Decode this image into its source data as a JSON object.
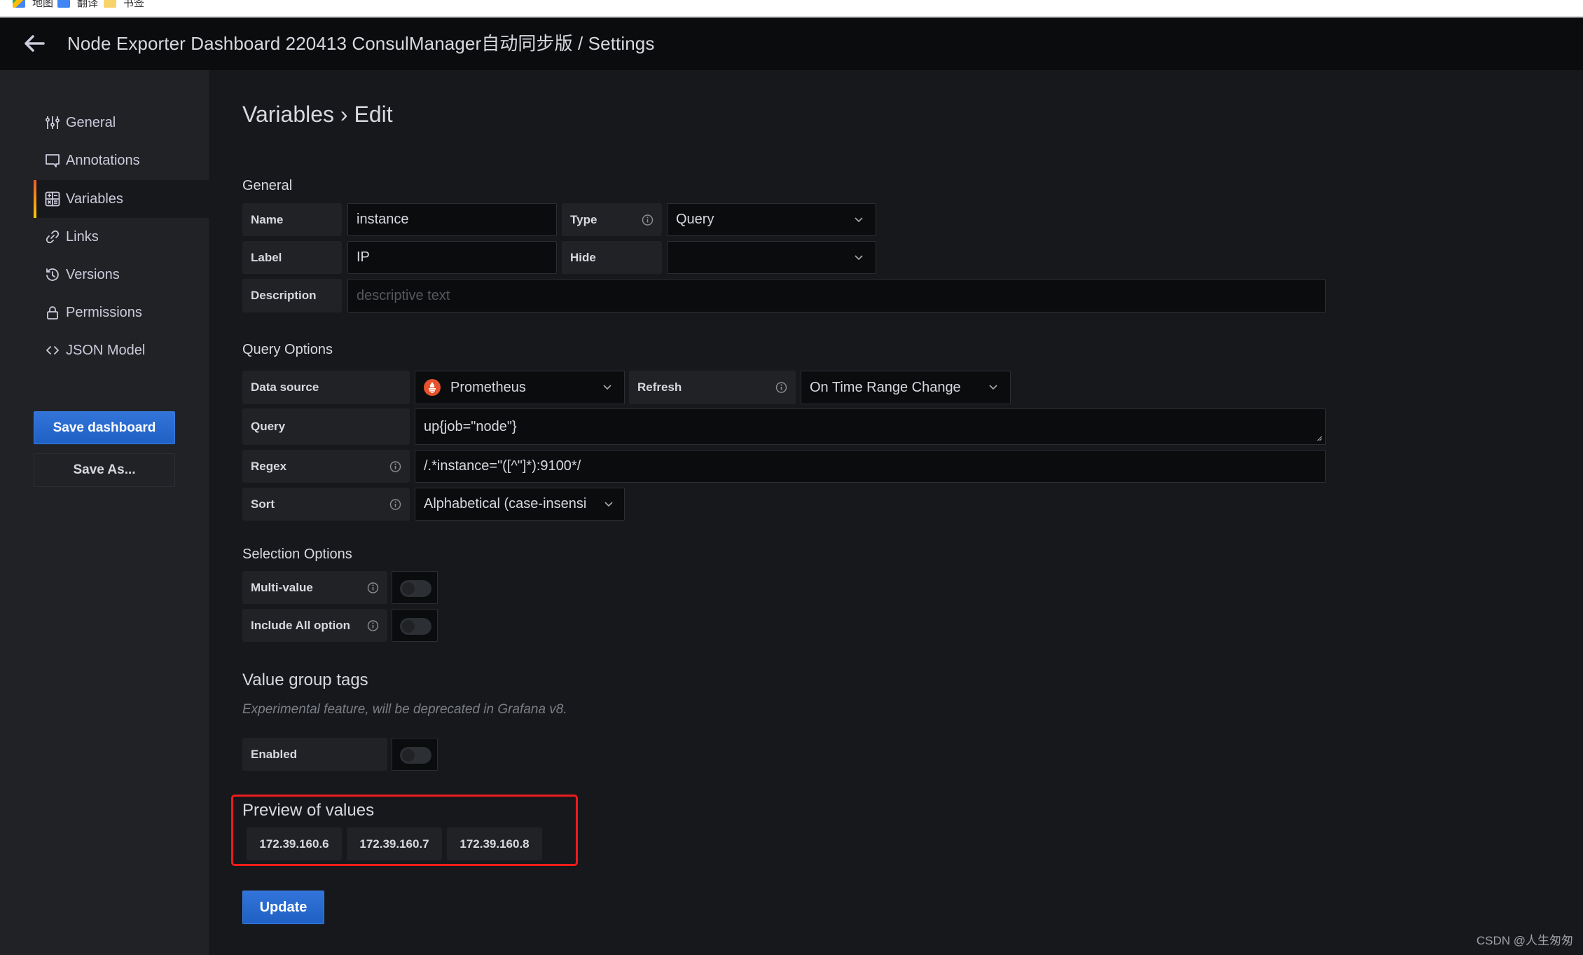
{
  "browser": {
    "bookmarks": [
      {
        "label": "地图",
        "icon": "maps-icon"
      },
      {
        "label": "翻译",
        "icon": "translate-icon"
      },
      {
        "label": "书签",
        "icon": "folder-icon"
      }
    ]
  },
  "header": {
    "title": "Node Exporter Dashboard 220413 ConsulManager自动同步版 / Settings",
    "back_icon": "arrow-left-icon"
  },
  "sidebar": {
    "items": [
      {
        "label": "General",
        "icon": "sliders-icon",
        "active": false
      },
      {
        "label": "Annotations",
        "icon": "comment-icon",
        "active": false
      },
      {
        "label": "Variables",
        "icon": "calculator-icon",
        "active": true
      },
      {
        "label": "Links",
        "icon": "link-icon",
        "active": false
      },
      {
        "label": "Versions",
        "icon": "history-icon",
        "active": false
      },
      {
        "label": "Permissions",
        "icon": "lock-icon",
        "active": false
      },
      {
        "label": "JSON Model",
        "icon": "code-icon",
        "active": false
      }
    ],
    "save_label": "Save dashboard",
    "save_as_label": "Save As..."
  },
  "main": {
    "page_title": "Variables › Edit",
    "general": {
      "heading": "General",
      "name_label": "Name",
      "name_value": "instance",
      "type_label": "Type",
      "type_value": "Query",
      "label_label": "Label",
      "label_value": "IP",
      "hide_label": "Hide",
      "hide_value": "",
      "description_label": "Description",
      "description_placeholder": "descriptive text",
      "description_value": ""
    },
    "query_options": {
      "heading": "Query Options",
      "datasource_label": "Data source",
      "datasource_value": "Prometheus",
      "refresh_label": "Refresh",
      "refresh_value": "On Time Range Change",
      "query_label": "Query",
      "query_value": "up{job=\"node\"}",
      "regex_label": "Regex",
      "regex_value": "/.*instance=\"([^\"]*):9100*/",
      "sort_label": "Sort",
      "sort_value": "Alphabetical (case-insensi"
    },
    "selection_options": {
      "heading": "Selection Options",
      "multi_value_label": "Multi-value",
      "multi_value_on": false,
      "include_all_label": "Include All option",
      "include_all_on": false
    },
    "value_group_tags": {
      "heading": "Value group tags",
      "note": "Experimental feature, will be deprecated in Grafana v8.",
      "enabled_label": "Enabled",
      "enabled_on": false
    },
    "preview": {
      "heading": "Preview of values",
      "values": [
        "172.39.160.6",
        "172.39.160.7",
        "172.39.160.8"
      ]
    },
    "update_label": "Update"
  },
  "colors": {
    "accent_blue": "#3274d9",
    "active_indicator_start": "#f05a28",
    "active_indicator_end": "#fbca0a",
    "annotation_red": "#ec1c1c",
    "prometheus_orange": "#e6522c"
  },
  "watermark": "CSDN @人生匆匆"
}
